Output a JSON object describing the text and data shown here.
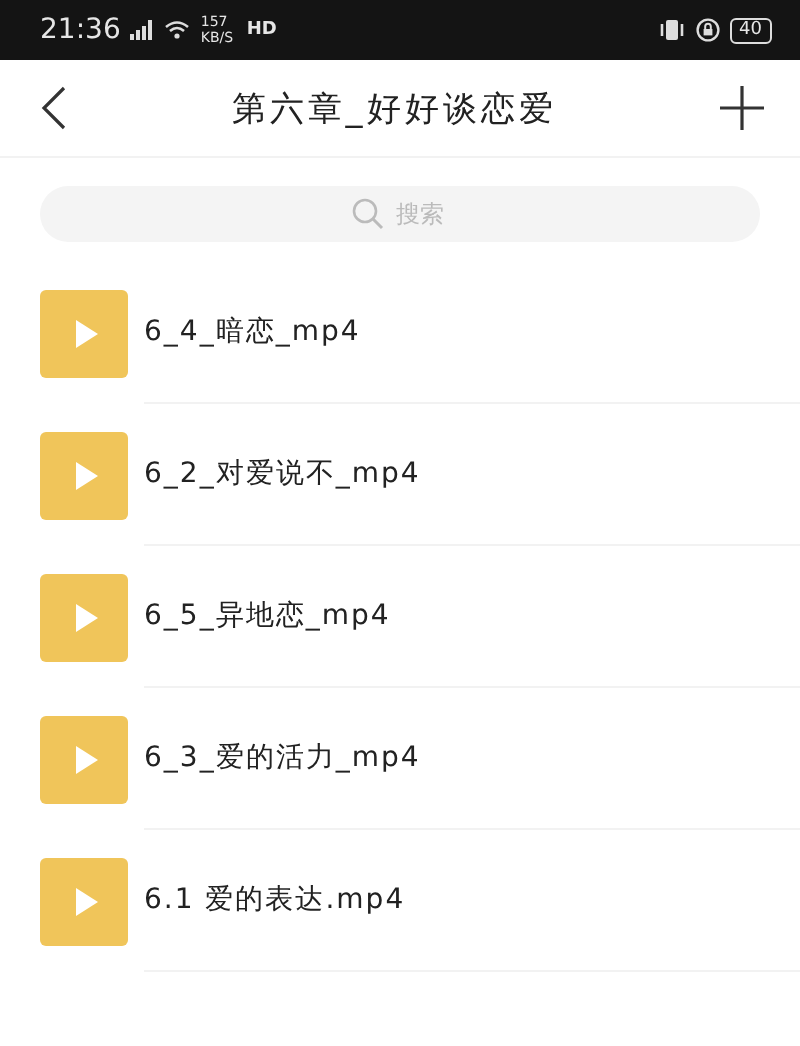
{
  "status_bar": {
    "time": "21:36",
    "network_speed": "157 KB/S",
    "hd": "HD",
    "battery": "40"
  },
  "header": {
    "title": "第六章_好好谈恋爱"
  },
  "search": {
    "placeholder": "搜索"
  },
  "files": [
    {
      "name": "6_4_暗恋_mp4"
    },
    {
      "name": "6_2_对爱说不_mp4"
    },
    {
      "name": "6_5_异地恋_mp4"
    },
    {
      "name": "6_3_爱的活力_mp4"
    },
    {
      "name": "6.1 爱的表达.mp4"
    }
  ]
}
